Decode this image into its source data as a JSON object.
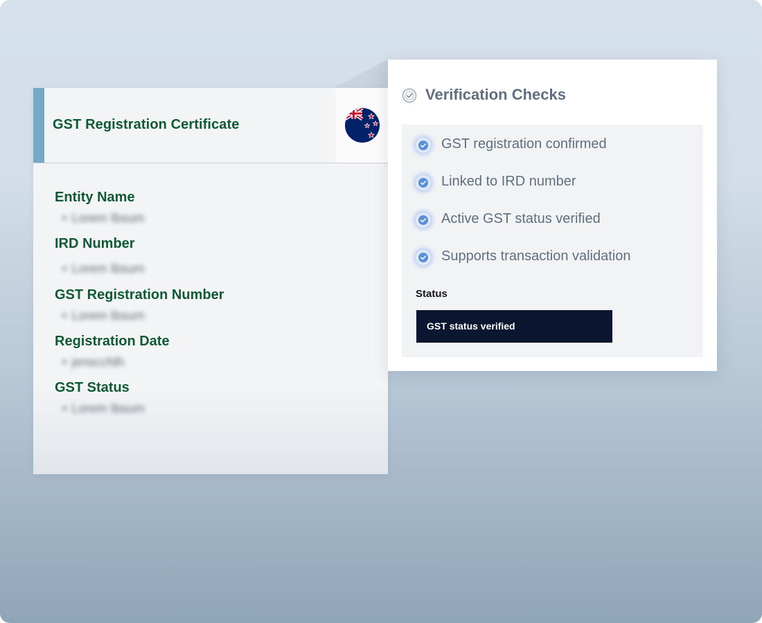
{
  "certificate": {
    "title": "GST Registration Certificate",
    "accent_color": "#75a9c4",
    "label_color": "#0f5a34",
    "flag_icon": "new-zealand-flag-icon",
    "fields": [
      {
        "label": "Entity Name",
        "value": "+ Lorem Ibsum"
      },
      {
        "label": "IRD Number",
        "value": "+ Lorem Ibsum"
      },
      {
        "label": "GST Registration Number",
        "value": "+ Lorem Ibsum"
      },
      {
        "label": "Registration Date",
        "value": "+ jensccfdh"
      },
      {
        "label": "GST Status",
        "value": "+ Lorem Ibsum"
      }
    ]
  },
  "verification": {
    "title": "Verification Checks",
    "title_icon": "check-circle-icon",
    "check_icon": "checkmark-badge-icon",
    "checks": [
      "GST registration confirmed",
      "Linked to IRD number",
      "Active GST status verified",
      "Supports transaction validation"
    ],
    "status_label": "Status",
    "status_value": "GST status verified",
    "status_bg_color": "#0b1630"
  }
}
